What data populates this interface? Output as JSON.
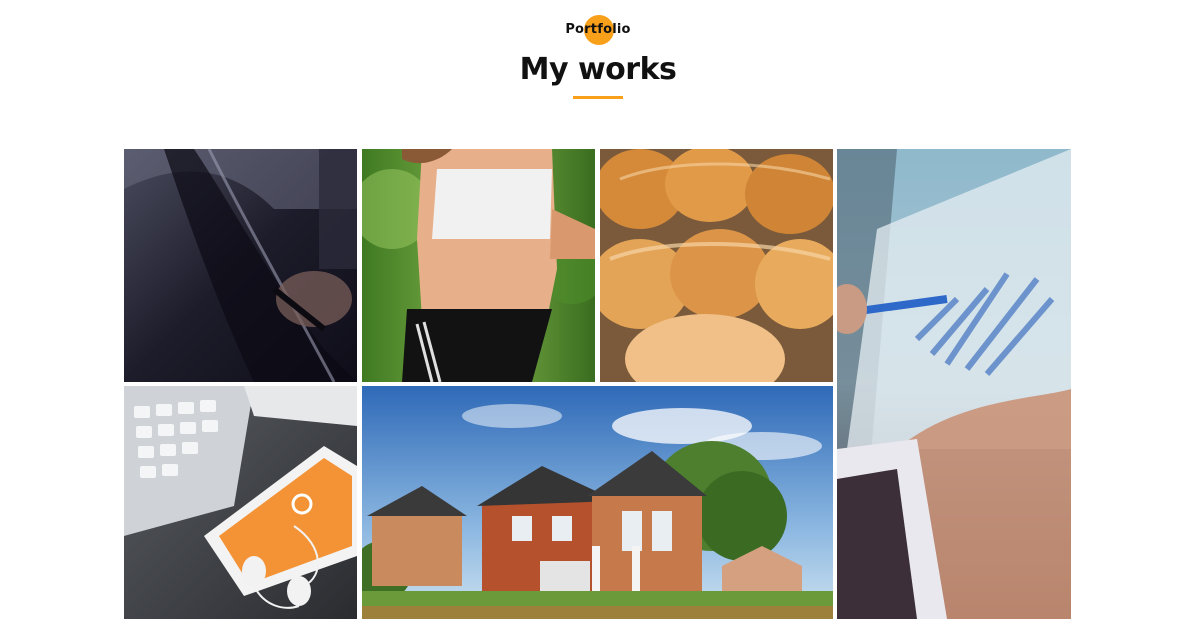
{
  "section": {
    "eyebrow": "Portfolio",
    "title": "My works"
  },
  "colors": {
    "accent": "#f9a01b",
    "text": "#111111",
    "background": "#ffffff"
  },
  "gallery": {
    "items": [
      {
        "icon": "car-door-photo"
      },
      {
        "icon": "runner-photo"
      },
      {
        "icon": "bread-photo"
      },
      {
        "icon": "business-chart-photo"
      },
      {
        "icon": "phone-keyboard-photo"
      },
      {
        "icon": "house-photo"
      }
    ]
  }
}
